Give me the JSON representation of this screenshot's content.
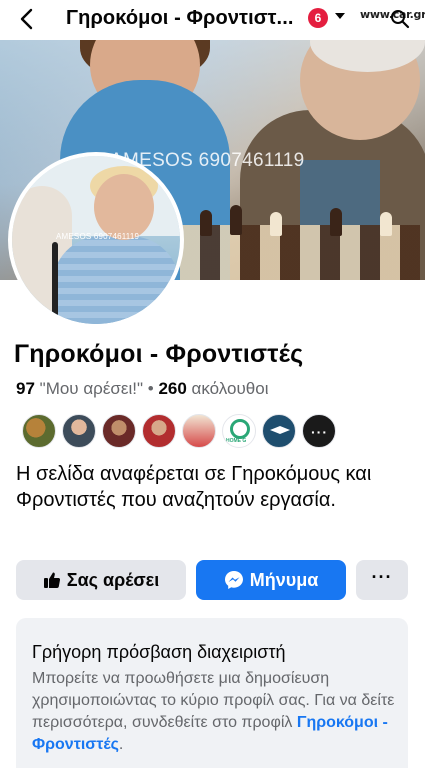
{
  "topbar": {
    "title": "Γηροκόμοι - Φροντιστ...",
    "notification_count": "6",
    "watermark": "www.car.gr",
    "icons": [
      "back-arrow-icon",
      "dropdown-caret-icon",
      "search-icon"
    ]
  },
  "cover": {
    "watermark": "AMESOS 6907461119"
  },
  "avatar": {
    "watermark": "AMESOS 6907461119"
  },
  "page": {
    "name": "Γηροκόμοι - Φροντιστές",
    "likes_count": "97",
    "likes_label": "\"Μου αρέσει!\"",
    "separator": "•",
    "followers_count": "260",
    "followers_label": "ακόλουθοι",
    "about": "Η σελίδα αναφέρεται σε Γηροκόμους και Φροντιστές που αναζητούν εργασία.",
    "friends_avatars": 8,
    "friend_badge_text": "HOME G"
  },
  "actions": {
    "like_label": "Σας αρέσει",
    "message_label": "Μήνυμα",
    "more_label": "···",
    "colors": {
      "primary": "#1877f2",
      "secondary": "#e4e6eb"
    }
  },
  "admin_card": {
    "title": "Γρήγορη πρόσβαση διαχειριστή",
    "body_prefix": "Μπορείτε να προωθήσετε μια δημοσίευση χρησιμοποιώντας το κύριο προφίλ σας. Για να δείτε περισσότερα, συνδεθείτε στο προφίλ ",
    "body_link": "Γηροκόμοι - Φροντιστές",
    "body_suffix": "."
  }
}
